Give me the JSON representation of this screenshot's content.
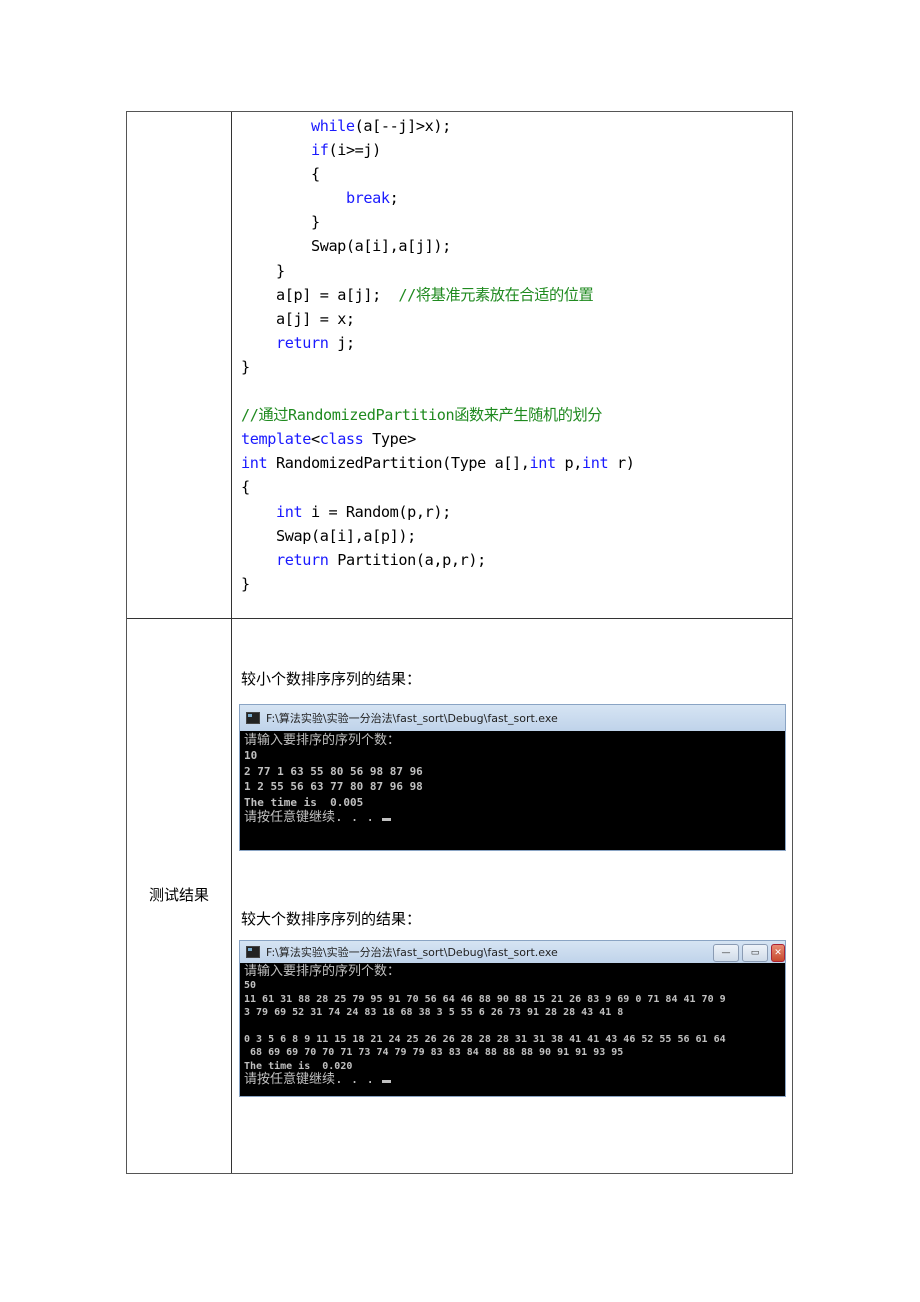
{
  "document": {
    "code_lines": [
      {
        "indent": "        ",
        "parts": [
          {
            "t": "while",
            "c": "kw"
          },
          {
            "t": "(a[--j]>x);",
            "c": ""
          }
        ]
      },
      {
        "indent": "        ",
        "parts": [
          {
            "t": "if",
            "c": "kw"
          },
          {
            "t": "(i>=j)",
            "c": ""
          }
        ]
      },
      {
        "indent": "        ",
        "parts": [
          {
            "t": "{",
            "c": ""
          }
        ]
      },
      {
        "indent": "            ",
        "parts": [
          {
            "t": "break",
            "c": "kw"
          },
          {
            "t": ";",
            "c": ""
          }
        ]
      },
      {
        "indent": "        ",
        "parts": [
          {
            "t": "}",
            "c": ""
          }
        ]
      },
      {
        "indent": "        ",
        "parts": [
          {
            "t": "Swap(a[i],a[j]);",
            "c": ""
          }
        ]
      },
      {
        "indent": "    ",
        "parts": [
          {
            "t": "}",
            "c": ""
          }
        ]
      },
      {
        "indent": "    ",
        "parts": [
          {
            "t": "a[p] = a[j];  ",
            "c": ""
          },
          {
            "t": "//将基准元素放在合适的位置",
            "c": "cm"
          }
        ]
      },
      {
        "indent": "    ",
        "parts": [
          {
            "t": "a[j] = x;",
            "c": ""
          }
        ]
      },
      {
        "indent": "    ",
        "parts": [
          {
            "t": "return",
            "c": "kw"
          },
          {
            "t": " j;",
            "c": ""
          }
        ]
      },
      {
        "indent": "",
        "parts": [
          {
            "t": "}",
            "c": ""
          }
        ]
      },
      {
        "indent": "",
        "parts": [
          {
            "t": "",
            "c": ""
          }
        ]
      },
      {
        "indent": "",
        "parts": [
          {
            "t": "//通过RandomizedPartition函数来产生随机的划分",
            "c": "cm"
          }
        ]
      },
      {
        "indent": "",
        "parts": [
          {
            "t": "template",
            "c": "kw"
          },
          {
            "t": "<",
            "c": ""
          },
          {
            "t": "class",
            "c": "kw"
          },
          {
            "t": " Type>",
            "c": ""
          }
        ]
      },
      {
        "indent": "",
        "parts": [
          {
            "t": "int",
            "c": "kw"
          },
          {
            "t": " RandomizedPartition(Type a[],",
            "c": ""
          },
          {
            "t": "int",
            "c": "kw"
          },
          {
            "t": " p,",
            "c": ""
          },
          {
            "t": "int",
            "c": "kw"
          },
          {
            "t": " r)",
            "c": ""
          }
        ]
      },
      {
        "indent": "",
        "parts": [
          {
            "t": "{",
            "c": ""
          }
        ]
      },
      {
        "indent": "    ",
        "parts": [
          {
            "t": "int",
            "c": "kw"
          },
          {
            "t": " i = Random(p,r);",
            "c": ""
          }
        ]
      },
      {
        "indent": "    ",
        "parts": [
          {
            "t": "Swap(a[i],a[p]);",
            "c": ""
          }
        ]
      },
      {
        "indent": "    ",
        "parts": [
          {
            "t": "return",
            "c": "kw"
          },
          {
            "t": " Partition(a,p,r);",
            "c": ""
          }
        ]
      },
      {
        "indent": "",
        "parts": [
          {
            "t": "}",
            "c": ""
          }
        ]
      }
    ],
    "test_label": "测试结果",
    "small_caption": "较小个数排序序列的结果：",
    "large_caption": "较大个数排序序列的结果：",
    "console_small": {
      "title": "F:\\算法实验\\实验一分治法\\fast_sort\\Debug\\fast_sort.exe",
      "lines": [
        "请输入要排序的序列个数：",
        "10",
        "2 77 1 63 55 80 56 98 87 96",
        "1 2 55 56 63 77 80 87 96 98",
        "The time is  0.005",
        "请按任意键继续. . . "
      ]
    },
    "console_large": {
      "title": "F:\\算法实验\\实验一分治法\\fast_sort\\Debug\\fast_sort.exe",
      "lines": [
        "请输入要排序的序列个数：",
        "50",
        "11 61 31 88 28 25 79 95 91 70 56 64 46 88 90 88 15 21 26 83 9 69 0 71 84 41 70 9",
        "3 79 69 52 31 74 24 83 18 68 38 3 5 55 6 26 73 91 28 28 43 41 8",
        "",
        "0 3 5 6 8 9 11 15 18 21 24 25 26 26 28 28 28 31 31 38 41 41 43 46 52 55 56 61 64",
        " 68 69 69 70 70 71 73 74 79 79 83 83 84 88 88 88 90 91 91 93 95",
        "The time is  0.020",
        "请按任意键继续. . . "
      ],
      "buttons": {
        "minimize": "—",
        "maximize": "▭",
        "close": "✕"
      }
    }
  },
  "colors": {
    "keyword": "#1a1aff",
    "comment": "#1f8a1f",
    "console_bg": "#000000",
    "console_text": "#c0c0c0"
  }
}
